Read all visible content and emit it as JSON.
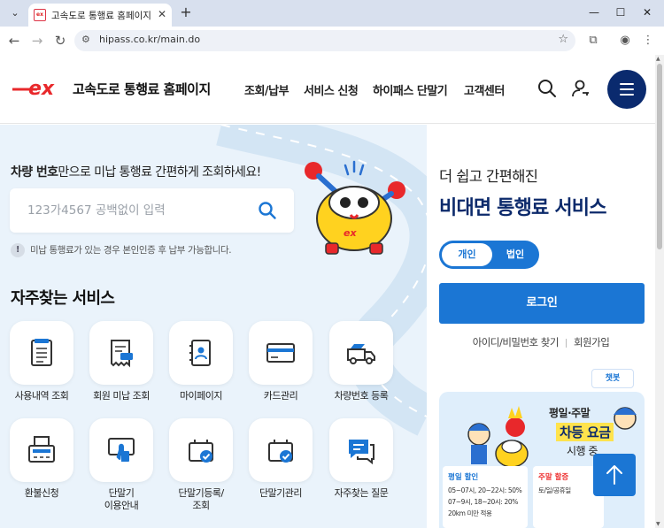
{
  "browser": {
    "tab_title": "고속도로 통행료 홈페이지",
    "tab_favicon": "ex",
    "url": "hipass.co.kr/main.do",
    "icons": {
      "tab_list": "chevron-down-icon",
      "close_tab": "close-icon",
      "new_tab": "plus-icon",
      "minimize": "minimize-icon",
      "maximize": "maximize-icon",
      "close_window": "close-icon",
      "back": "arrow-left-icon",
      "forward": "arrow-right-icon",
      "reload": "reload-icon",
      "site_info": "tune-icon",
      "bookmark": "star-icon",
      "extensions": "puzzle-icon",
      "profile": "profile-icon",
      "menu": "kebab-icon"
    },
    "glyphs": {
      "tab_list": "⌄",
      "close_tab": "✕",
      "new_tab": "+",
      "minimize": "—",
      "maximize": "☐",
      "close_window": "✕",
      "back": "←",
      "forward": "→",
      "reload": "↻",
      "site_info": "⚙",
      "bookmark": "☆",
      "extensions": "⧉",
      "profile": "◉",
      "menu": "⋮"
    }
  },
  "header": {
    "site_title": "고속도로 통행료 홈페이지",
    "nav": [
      "조회/납부",
      "서비스 신청",
      "하이패스 단말기",
      "고객센터"
    ]
  },
  "colors": {
    "brand_red": "#e8282b",
    "brand_navy": "#0a2a6e",
    "accent_blue": "#1b76d4",
    "panel_bg": "#eaf3fb"
  },
  "lookup": {
    "title_bold": "차량 번호",
    "title_rest": "만으로 미납 통행료 간편하게 조회하세요!",
    "placeholder": "123가4567 공백없이 입력",
    "notice_mark": "!",
    "notice": "미납 통행료가 있는 경우 본인인증 후 납부 가능합니다."
  },
  "favorites": {
    "title": "자주찾는 서비스",
    "items": [
      {
        "label": "사용내역 조회",
        "icon": "receipt-list-icon"
      },
      {
        "label": "회원 미납 조회",
        "icon": "bill-icon"
      },
      {
        "label": "마이페이지",
        "icon": "contact-book-icon"
      },
      {
        "label": "카드관리",
        "icon": "credit-card-icon"
      },
      {
        "label": "차량번호 등록",
        "icon": "truck-icon"
      },
      {
        "label": "환불신청",
        "icon": "fax-icon"
      },
      {
        "label": "단말기\n이용안내",
        "icon": "touch-device-icon"
      },
      {
        "label": "단말기등록/\n조회",
        "icon": "device-check-icon"
      },
      {
        "label": "단말기관리",
        "icon": "device-manage-icon"
      },
      {
        "label": "자주찾는 질문",
        "icon": "chat-bubble-icon"
      }
    ]
  },
  "contactless": {
    "subtitle": "더 쉽고 간편해진",
    "title": "비대면 통행료 서비스",
    "toggle": [
      "개인",
      "법인"
    ],
    "login": "로그인",
    "find_id": "아이디/비밀번호 찾기",
    "join": "회원가입",
    "chatbot": "챗봇"
  },
  "banner": {
    "line1": "평일·주말",
    "line2": "차등 요금",
    "line3": "시행 중",
    "weekday_title": "평일 할인",
    "weekday_lines": [
      "05~07시, 20~22시: 50%",
      "07~9시, 18~20시: 20%",
      "20km 미만 적용"
    ],
    "weekend_title": "주말 할증",
    "weekend_lines": [
      "토/일/공휴일"
    ]
  }
}
